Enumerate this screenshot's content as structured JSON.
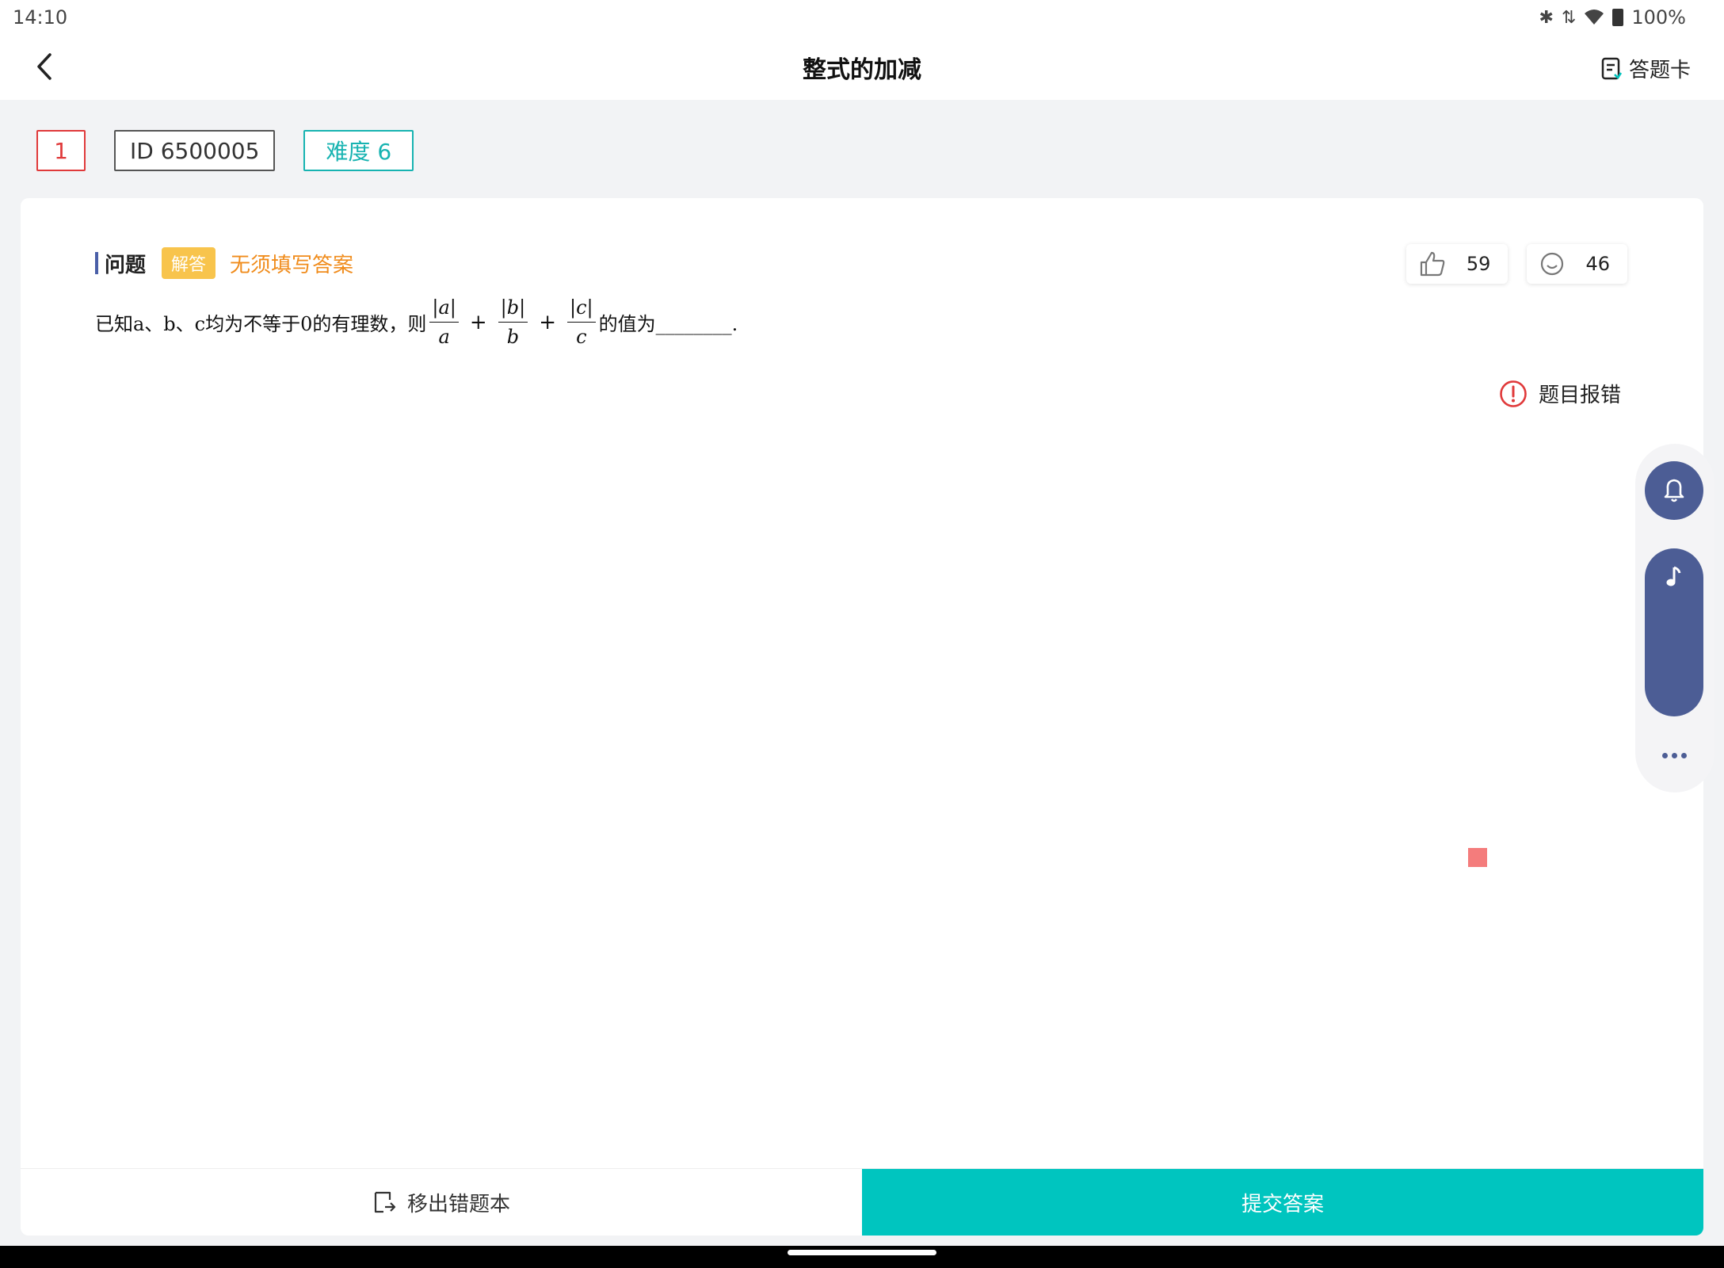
{
  "status_bar": {
    "time": "14:10",
    "battery": "100%"
  },
  "header": {
    "title": "整式的加减",
    "answer_card": "答题卡"
  },
  "tags": {
    "number": "1",
    "id": "ID 6500005",
    "difficulty": "难度 6"
  },
  "question": {
    "label": "问题",
    "type_badge": "解答",
    "hint": "无须填写答案",
    "text_prefix": "已知a、b、c均为不等于0的有理数，则",
    "fractions": [
      {
        "num": "|a|",
        "den": "a"
      },
      {
        "num": "|b|",
        "den": "b"
      },
      {
        "num": "|c|",
        "den": "c"
      }
    ],
    "plus": "+",
    "text_suffix": "的值为________."
  },
  "stats": {
    "likes": "59",
    "comments": "46"
  },
  "report_label": "题目报错",
  "bottom": {
    "remove_label": "移出错题本",
    "submit_label": "提交答案"
  },
  "colors": {
    "accent_teal": "#00c5bf",
    "number_red": "#e0393a",
    "badge_yellow": "#f8c44c",
    "hint_orange": "#f08c1c",
    "side_blue": "#4c5d95"
  }
}
